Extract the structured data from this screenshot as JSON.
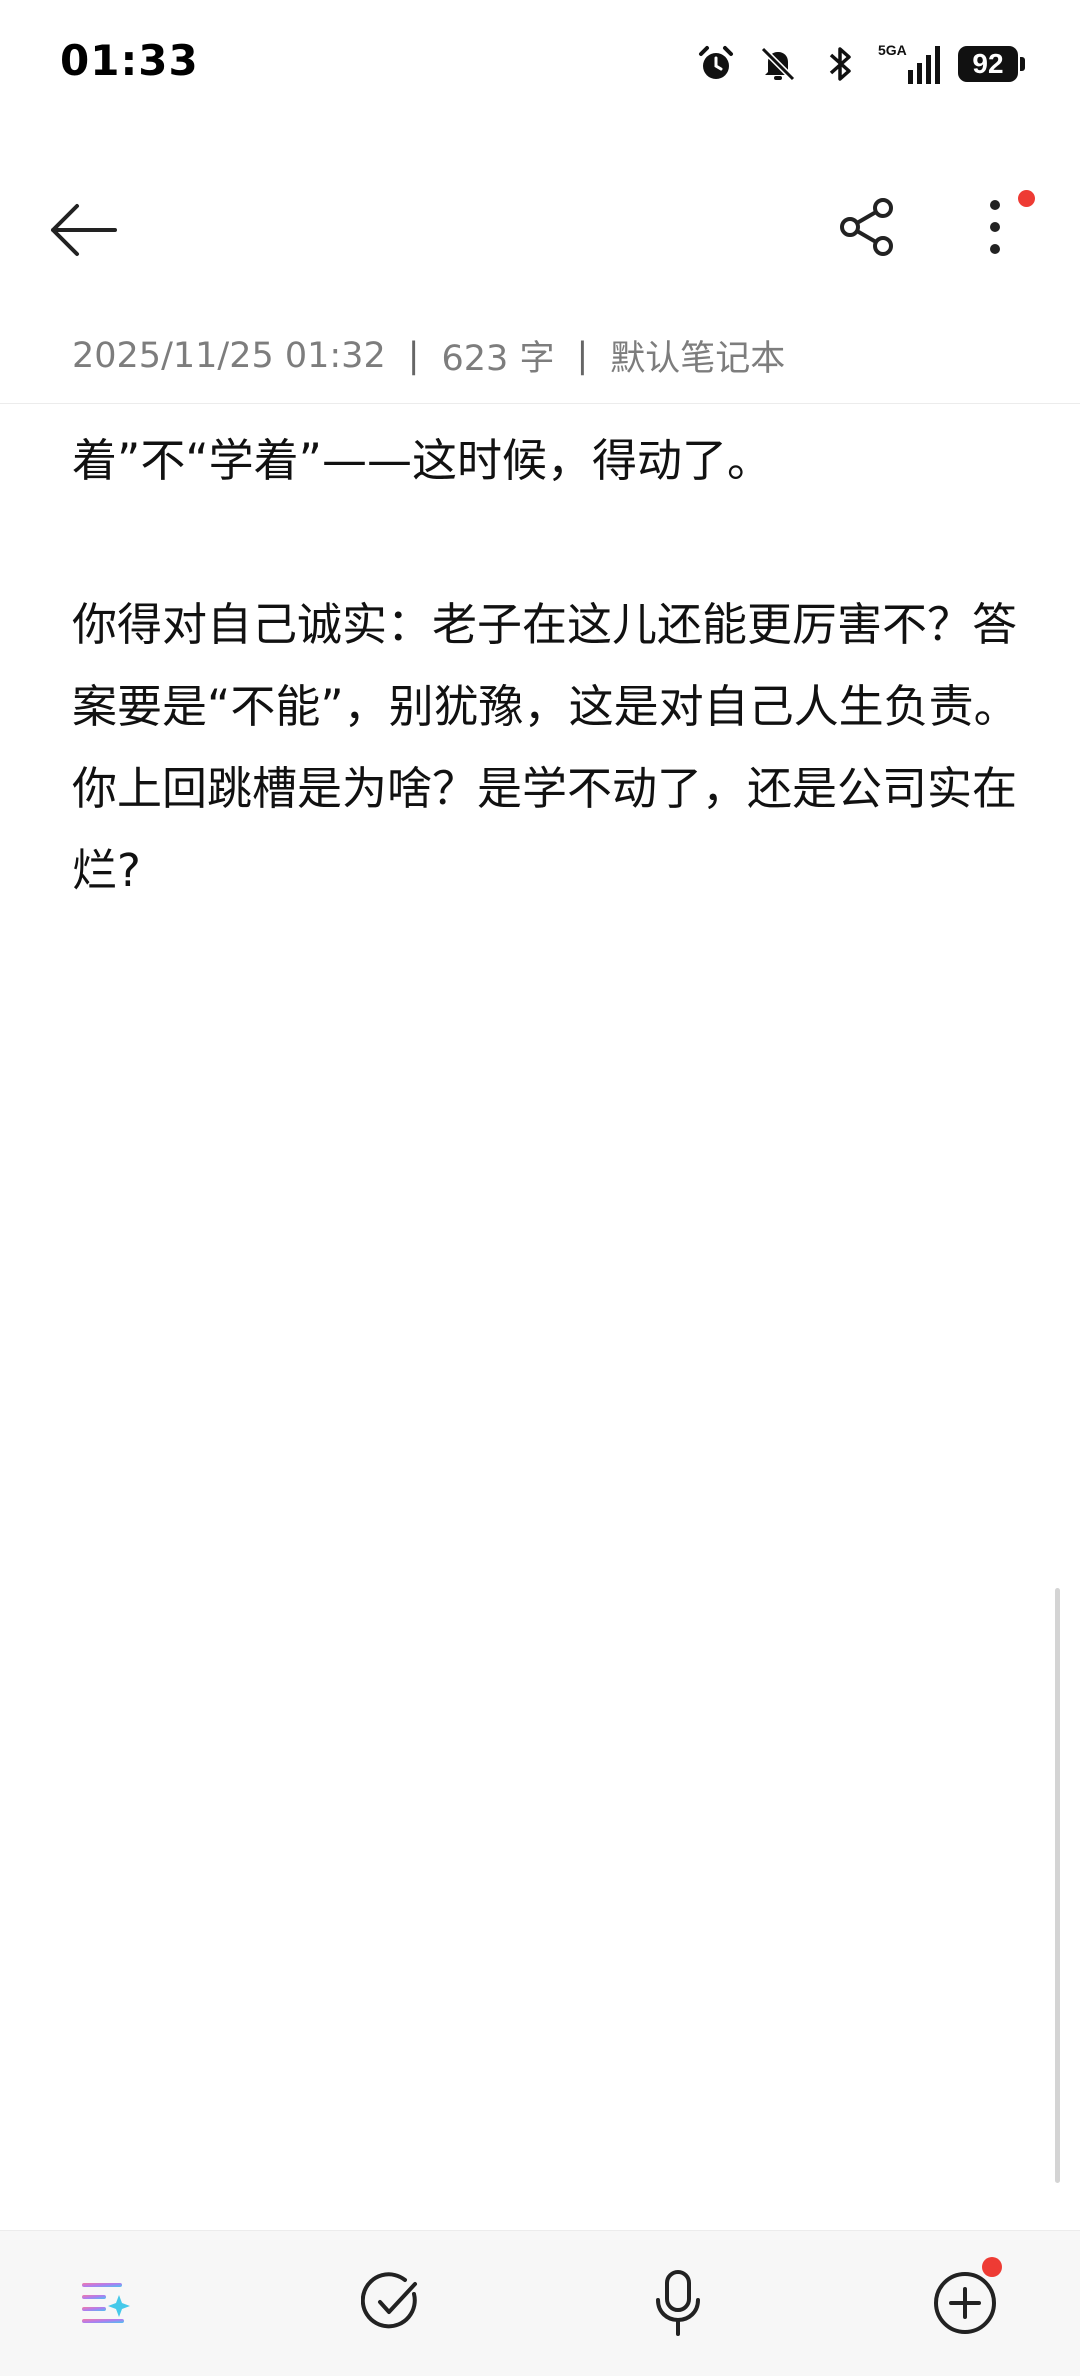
{
  "status_bar": {
    "time": "01:33",
    "network": "5GA",
    "battery": "92",
    "icons": [
      "alarm-icon",
      "bell-off-icon",
      "bluetooth-icon",
      "signal-5ga-icon",
      "battery-icon"
    ]
  },
  "toolbar": {
    "back_icon": "arrow-left-icon",
    "share_icon": "share-icon",
    "more_icon": "more-vertical-icon",
    "notification_dot_color": "#ee3b34"
  },
  "note": {
    "meta": {
      "datetime": "2025/11/25 01:32",
      "separator": "|",
      "word_count": "623 字",
      "notebook": "默认笔记本"
    },
    "paragraphs": [
      "着”不“学着”——这时候，得动了。",
      "",
      "你得对自己诚实：老子在这儿还能更厉害不？答案要是“不能”，别犹豫，这是对自己人生负责。你上回跳槽是为啥？是学不动了，还是公司实在烂?"
    ]
  },
  "bottom_bar": {
    "items": [
      {
        "icon": "ai-format-icon"
      },
      {
        "icon": "checklist-icon"
      },
      {
        "icon": "microphone-icon"
      },
      {
        "icon": "add-icon"
      }
    ]
  }
}
